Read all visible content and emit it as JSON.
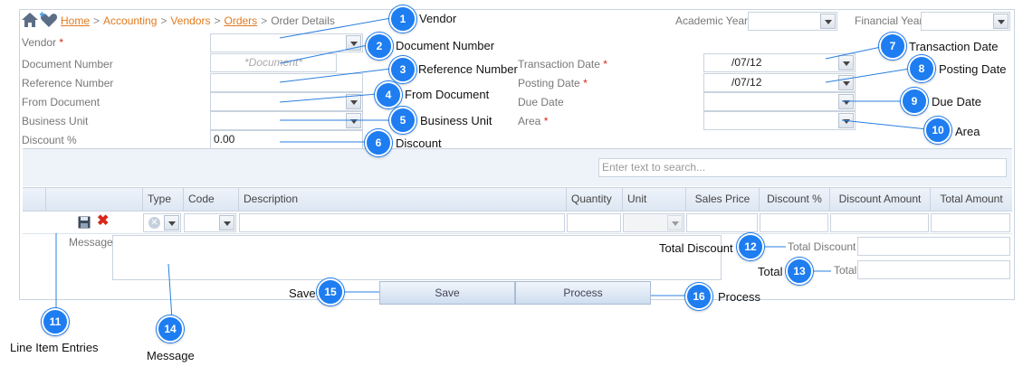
{
  "breadcrumb": {
    "home": "Home",
    "accounting": "Accounting",
    "vendors": "Vendors",
    "orders": "Orders",
    "current": "Order Details",
    "separator": ">"
  },
  "header_fields": {
    "academic_year": "Academic Year",
    "financial_year": "Financial Year"
  },
  "form": {
    "vendor_label": "Vendor",
    "document_number_label": "Document Number",
    "document_number_placeholder": "*Document*",
    "reference_number_label": "Reference Number",
    "from_document_label": "From Document",
    "business_unit_label": "Business Unit",
    "discount_label": "Discount %",
    "discount_value": "0.00",
    "transaction_date_label": "Transaction Date",
    "transaction_date_value": "/07/12",
    "posting_date_label": "Posting Date",
    "posting_date_value": "/07/12",
    "due_date_label": "Due Date",
    "area_label": "Area",
    "required_mark": "*"
  },
  "grid": {
    "search_placeholder": "Enter text to search...",
    "columns": [
      "Type",
      "Code",
      "Description",
      "Quantity",
      "Unit",
      "Sales Price",
      "Discount %",
      "Discount Amount",
      "Total Amount"
    ]
  },
  "message_label": "Message",
  "totals": {
    "total_discount_label": "Total Discount",
    "total_label": "Total"
  },
  "actions": {
    "save": "Save",
    "process": "Process"
  },
  "callouts": [
    {
      "number": "1",
      "label": "Vendor"
    },
    {
      "number": "2",
      "label": "Document Number"
    },
    {
      "number": "3",
      "label": "Reference Number"
    },
    {
      "number": "4",
      "label": "From Document"
    },
    {
      "number": "5",
      "label": "Business Unit"
    },
    {
      "number": "6",
      "label": "Discount"
    },
    {
      "number": "7",
      "label": "Transaction Date"
    },
    {
      "number": "8",
      "label": "Posting Date"
    },
    {
      "number": "9",
      "label": "Due Date"
    },
    {
      "number": "10",
      "label": "Area"
    },
    {
      "number": "11",
      "label": "Line Item Entries"
    },
    {
      "number": "12",
      "label": "Total Discount"
    },
    {
      "number": "13",
      "label": "Total"
    },
    {
      "number": "14",
      "label": "Message"
    },
    {
      "number": "15",
      "label": "Save"
    },
    {
      "number": "16",
      "label": "Process"
    }
  ],
  "colors": {
    "accent_link": "#e07a1f",
    "callout": "#1e7df0",
    "required": "#d9261c"
  }
}
